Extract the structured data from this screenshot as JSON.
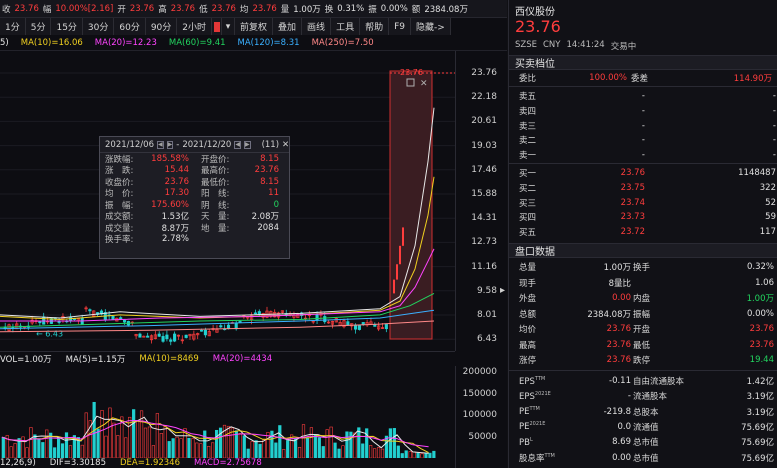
{
  "quote_bar": {
    "items": [
      {
        "label": "收",
        "value": "23.76",
        "color": "red"
      },
      {
        "label": "幅",
        "value": "10.00%[2.16]",
        "color": "red"
      },
      {
        "label": "开",
        "value": "23.76",
        "color": "red"
      },
      {
        "label": "高",
        "value": "23.76",
        "color": "red"
      },
      {
        "label": "低",
        "value": "23.76",
        "color": "red"
      },
      {
        "label": "均",
        "value": "23.76",
        "color": "red"
      },
      {
        "label": "量",
        "value": "1.00万",
        "color": "white"
      },
      {
        "label": "换",
        "value": "0.31%",
        "color": "white"
      },
      {
        "label": "振",
        "value": "0.00%",
        "color": "white"
      },
      {
        "label": "额",
        "value": "2384.08万",
        "color": "white"
      }
    ]
  },
  "toolbar": {
    "periods": [
      "1分",
      "5分",
      "15分",
      "30分",
      "60分",
      "90分",
      "2小时"
    ],
    "buttons": [
      "前复权",
      "叠加",
      "画线",
      "工具",
      "帮助",
      "F9",
      "隐藏->"
    ]
  },
  "ma_legend": [
    {
      "text": "5)",
      "color": "#e8e8e8"
    },
    {
      "text": "MA(10)=16.06",
      "color": "#f0d020"
    },
    {
      "text": "MA(20)=12.23",
      "color": "#ff44ff"
    },
    {
      "text": "MA(60)=9.41",
      "color": "#22d45f"
    },
    {
      "text": "MA(120)=8.31",
      "color": "#3ab0ff"
    },
    {
      "text": "MA(250)=7.50",
      "color": "#ff8888"
    }
  ],
  "price_axis": {
    "ticks": [
      "23.76",
      "22.18",
      "20.61",
      "19.03",
      "17.46",
      "15.88",
      "14.31",
      "12.73",
      "11.16",
      "9.58",
      "8.01",
      "6.43"
    ],
    "high_label": "23.76",
    "low_label": "6.43"
  },
  "volume_legend": [
    {
      "text": "VOL=1.00万",
      "color": "#e8e8e8"
    },
    {
      "text": "MA(5)=1.15万",
      "color": "#e8e8e8"
    },
    {
      "text": "MA(10)=8469",
      "color": "#f0d020"
    },
    {
      "text": "MA(20)=4434",
      "color": "#ff44ff"
    }
  ],
  "volume_axis": {
    "ticks": [
      "200000",
      "150000",
      "100000",
      "50000"
    ]
  },
  "macd_legend": [
    {
      "text": "12,26,9)",
      "color": "#e8e8e8"
    },
    {
      "text": "DIF=3.30185",
      "color": "#e8e8e8"
    },
    {
      "text": "DEA=1.92346",
      "color": "#f0d020"
    },
    {
      "text": "MACD=2.75678",
      "color": "#ff44ff"
    }
  ],
  "tooltip": {
    "range": "2021/12/06",
    "range_end": "2021/12/20",
    "sep": "-",
    "count": "(11)",
    "close_glyph": "✕",
    "rows": [
      {
        "k1": "涨跌幅:",
        "v1": "185.58%",
        "c1": "red",
        "k2": "开盘价:",
        "v2": "8.15",
        "c2": "red"
      },
      {
        "k1": "涨　跌:",
        "v1": "15.44",
        "c1": "red",
        "k2": "最高价:",
        "v2": "23.76",
        "c2": "red"
      },
      {
        "k1": "收盘价:",
        "v1": "23.76",
        "c1": "red",
        "k2": "最低价:",
        "v2": "8.15",
        "c2": "red"
      },
      {
        "k1": "均　价:",
        "v1": "17.30",
        "c1": "red",
        "k2": "阳　线:",
        "v2": "11",
        "c2": "red"
      },
      {
        "k1": "振　幅:",
        "v1": "175.60%",
        "c1": "red",
        "k2": "阴　线:",
        "v2": "0",
        "c2": "green"
      },
      {
        "k1": "成交额:",
        "v1": "1.53亿",
        "c1": "white",
        "k2": "天　量:",
        "v2": "2.08万",
        "c2": "white"
      },
      {
        "k1": "成交量:",
        "v1": "8.87万",
        "c1": "white",
        "k2": "地　量:",
        "v2": "2084",
        "c2": "white"
      },
      {
        "k1": "换手率:",
        "v1": "2.78%",
        "c1": "white",
        "k2": "",
        "v2": "",
        "c2": "white"
      }
    ]
  },
  "stock": {
    "name": "西仪股份",
    "price": "23.76",
    "code": "SZSE",
    "currency": "CNY",
    "time": "14:41:24",
    "status": "交易中"
  },
  "order_book": {
    "title": "买卖档位",
    "commission_ratio_label": "委比",
    "commission_ratio": "100.00%",
    "commission_diff_label": "委差",
    "commission_diff": "114.90万",
    "asks": [
      {
        "label": "卖五",
        "price": "-",
        "vol": "-"
      },
      {
        "label": "卖四",
        "price": "-",
        "vol": "-"
      },
      {
        "label": "卖三",
        "price": "-",
        "vol": "-"
      },
      {
        "label": "卖二",
        "price": "-",
        "vol": "-"
      },
      {
        "label": "卖一",
        "price": "-",
        "vol": "-"
      }
    ],
    "bids": [
      {
        "label": "买一",
        "price": "23.76",
        "vol": "1148487"
      },
      {
        "label": "买二",
        "price": "23.75",
        "vol": "322"
      },
      {
        "label": "买三",
        "price": "23.74",
        "vol": "52"
      },
      {
        "label": "买四",
        "price": "23.73",
        "vol": "59"
      },
      {
        "label": "买五",
        "price": "23.72",
        "vol": "117"
      }
    ]
  },
  "stats": {
    "title": "盘口数据",
    "rows": [
      {
        "k1": "总量",
        "v1": "1.00万",
        "c1": "white",
        "k2": "换手",
        "v2": "0.32%",
        "c2": "white"
      },
      {
        "k1": "现手",
        "v1": "8量比",
        "c1": "white",
        "k2": "",
        "v2": "1.06",
        "c2": "white"
      },
      {
        "k1": "外盘",
        "v1": "0.00",
        "c1": "red",
        "k2": "内盘",
        "v2": "1.00万",
        "c2": "green"
      },
      {
        "k1": "总额",
        "v1": "2384.08万",
        "c1": "white",
        "k2": "振幅",
        "v2": "0.00%",
        "c2": "white"
      },
      {
        "k1": "均价",
        "v1": "23.76",
        "c1": "red",
        "k2": "开盘",
        "v2": "23.76",
        "c2": "red"
      },
      {
        "k1": "最高",
        "v1": "23.76",
        "c1": "red",
        "k2": "最低",
        "v2": "23.76",
        "c2": "red"
      },
      {
        "k1": "涨停",
        "v1": "23.76",
        "c1": "red",
        "k2": "跌停",
        "v2": "19.44",
        "c2": "green"
      }
    ],
    "fin_rows": [
      {
        "k1": "EPS",
        "s1": "TTM",
        "v1": "-0.11",
        "k2": "自由流通股本",
        "v2": "1.42亿"
      },
      {
        "k1": "EPS",
        "s1": "2021E",
        "v1": "-",
        "k2": "流通股本",
        "v2": "3.19亿"
      },
      {
        "k1": "PE",
        "s1": "TTM",
        "v1": "-219.8",
        "k2": "总股本",
        "v2": "3.19亿"
      },
      {
        "k1": "PE",
        "s1": "2021E",
        "v1": "0.0",
        "k2": "流通值",
        "v2": "75.69亿"
      },
      {
        "k1": "PB",
        "s1": "L",
        "v1": "8.69",
        "k2": "总市值",
        "v2": "75.69亿"
      },
      {
        "k1": "股息率",
        "s1": "TTM",
        "v1": "0.00",
        "k2": "总市值",
        "v2": "75.69亿"
      }
    ]
  },
  "colors": {
    "red": "#ff3d3d",
    "green": "#22d45f",
    "white": "#e0e0e0"
  },
  "icons": {
    "dropdown": "chevron-down-icon",
    "collapse": "chevron-right-icon"
  }
}
